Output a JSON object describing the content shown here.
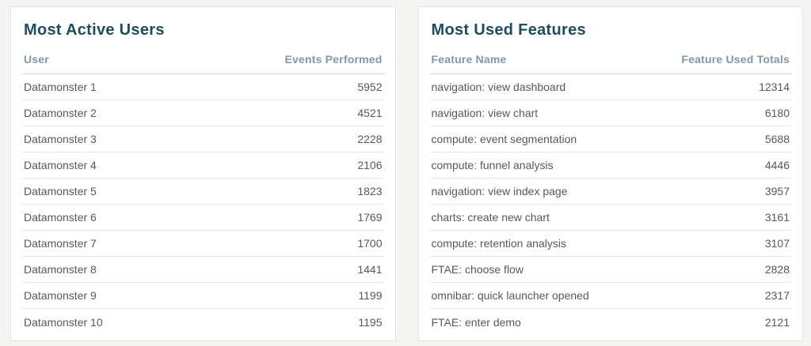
{
  "colors": {
    "page_background": "#f4f4f2",
    "card_background": "#ffffff",
    "card_border": "#e3e3e1",
    "title_text": "#1d4e5e",
    "column_header_text": "#7e99a7",
    "row_text": "#58585a",
    "row_divider": "#e5e5e3",
    "header_divider": "#d2d2d0"
  },
  "panels": [
    {
      "title": "Most Active Users",
      "columns": [
        "User",
        "Events Performed"
      ],
      "rows": [
        [
          "Datamonster 1",
          "5952"
        ],
        [
          "Datamonster 2",
          "4521"
        ],
        [
          "Datamonster 3",
          "2228"
        ],
        [
          "Datamonster 4",
          "2106"
        ],
        [
          "Datamonster 5",
          "1823"
        ],
        [
          "Datamonster 6",
          "1769"
        ],
        [
          "Datamonster 7",
          "1700"
        ],
        [
          "Datamonster 8",
          "1441"
        ],
        [
          "Datamonster 9",
          "1199"
        ],
        [
          "Datamonster 10",
          "1195"
        ]
      ]
    },
    {
      "title": "Most Used Features",
      "columns": [
        "Feature Name",
        "Feature Used Totals"
      ],
      "rows": [
        [
          "navigation: view dashboard",
          "12314"
        ],
        [
          "navigation: view chart",
          "6180"
        ],
        [
          "compute: event segmentation",
          "5688"
        ],
        [
          "compute: funnel analysis",
          "4446"
        ],
        [
          "navigation: view index page",
          "3957"
        ],
        [
          "charts: create new chart",
          "3161"
        ],
        [
          "compute: retention analysis",
          "3107"
        ],
        [
          "FTAE: choose flow",
          "2828"
        ],
        [
          "omnibar: quick launcher opened",
          "2317"
        ],
        [
          "FTAE: enter demo",
          "2121"
        ]
      ]
    }
  ]
}
